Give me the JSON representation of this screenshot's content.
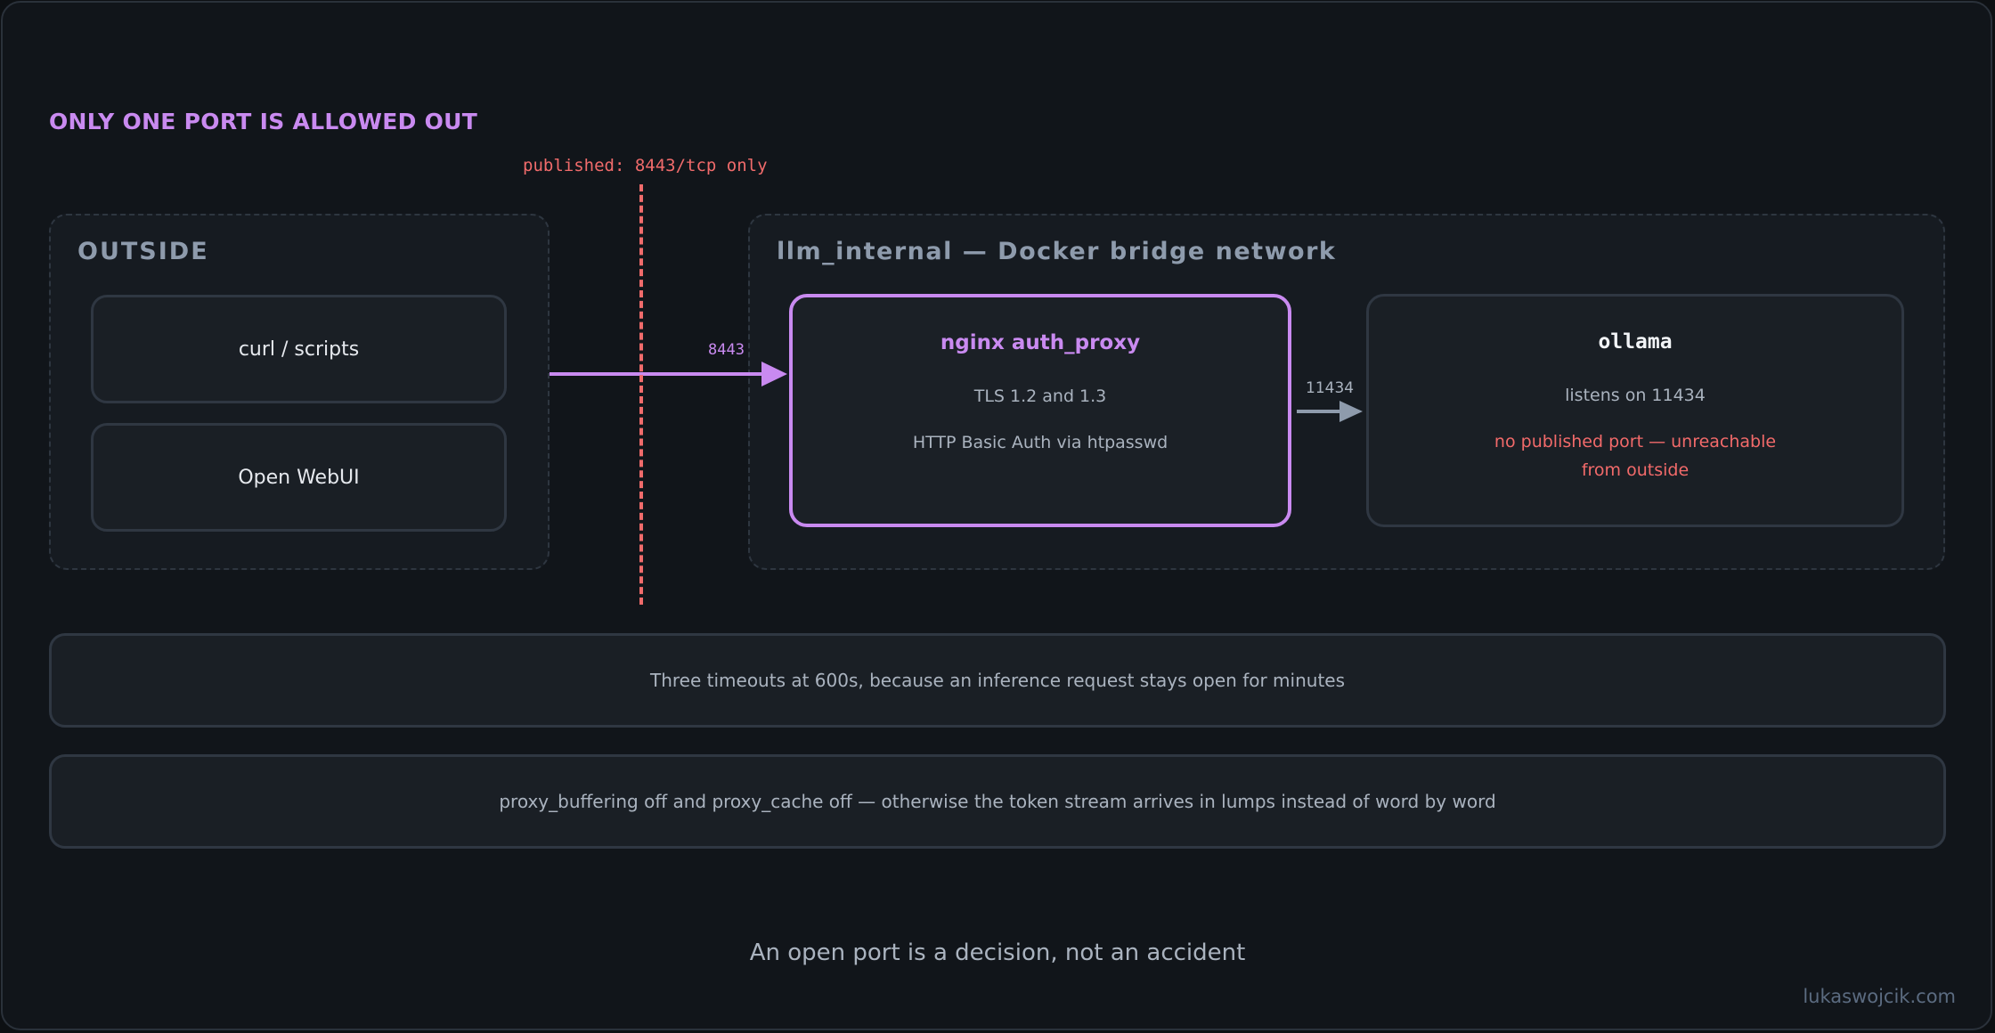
{
  "heading": "ONLY ONE PORT IS ALLOWED OUT",
  "boundary": {
    "label": "published: 8443/tcp only"
  },
  "outside": {
    "title": "OUTSIDE",
    "clients": [
      "curl / scripts",
      "Open WebUI"
    ]
  },
  "internal": {
    "title": "llm_internal — Docker bridge network",
    "proxy": {
      "title": "nginx auth_proxy",
      "lines": [
        "TLS 1.2 and 1.3",
        "HTTP Basic Auth via htpasswd"
      ]
    },
    "ollama": {
      "title": "ollama",
      "line": "listens on 11434",
      "warning": [
        "no published port — unreachable",
        "from outside"
      ]
    }
  },
  "edges": {
    "in_port": "8443",
    "proxy_to_ollama_port": "11434"
  },
  "notes": [
    "Three timeouts at 600s, because an inference request stays open for minutes",
    "proxy_buffering off and proxy_cache off — otherwise the token stream arrives in lumps instead of word by word"
  ],
  "tagline": "An open port is a decision, not an accident",
  "credit": "lukaswojcik.com",
  "colors": {
    "accent": "#c98af0",
    "danger": "#f06b6b",
    "muted": "#aab3bf",
    "background": "#11151a"
  }
}
